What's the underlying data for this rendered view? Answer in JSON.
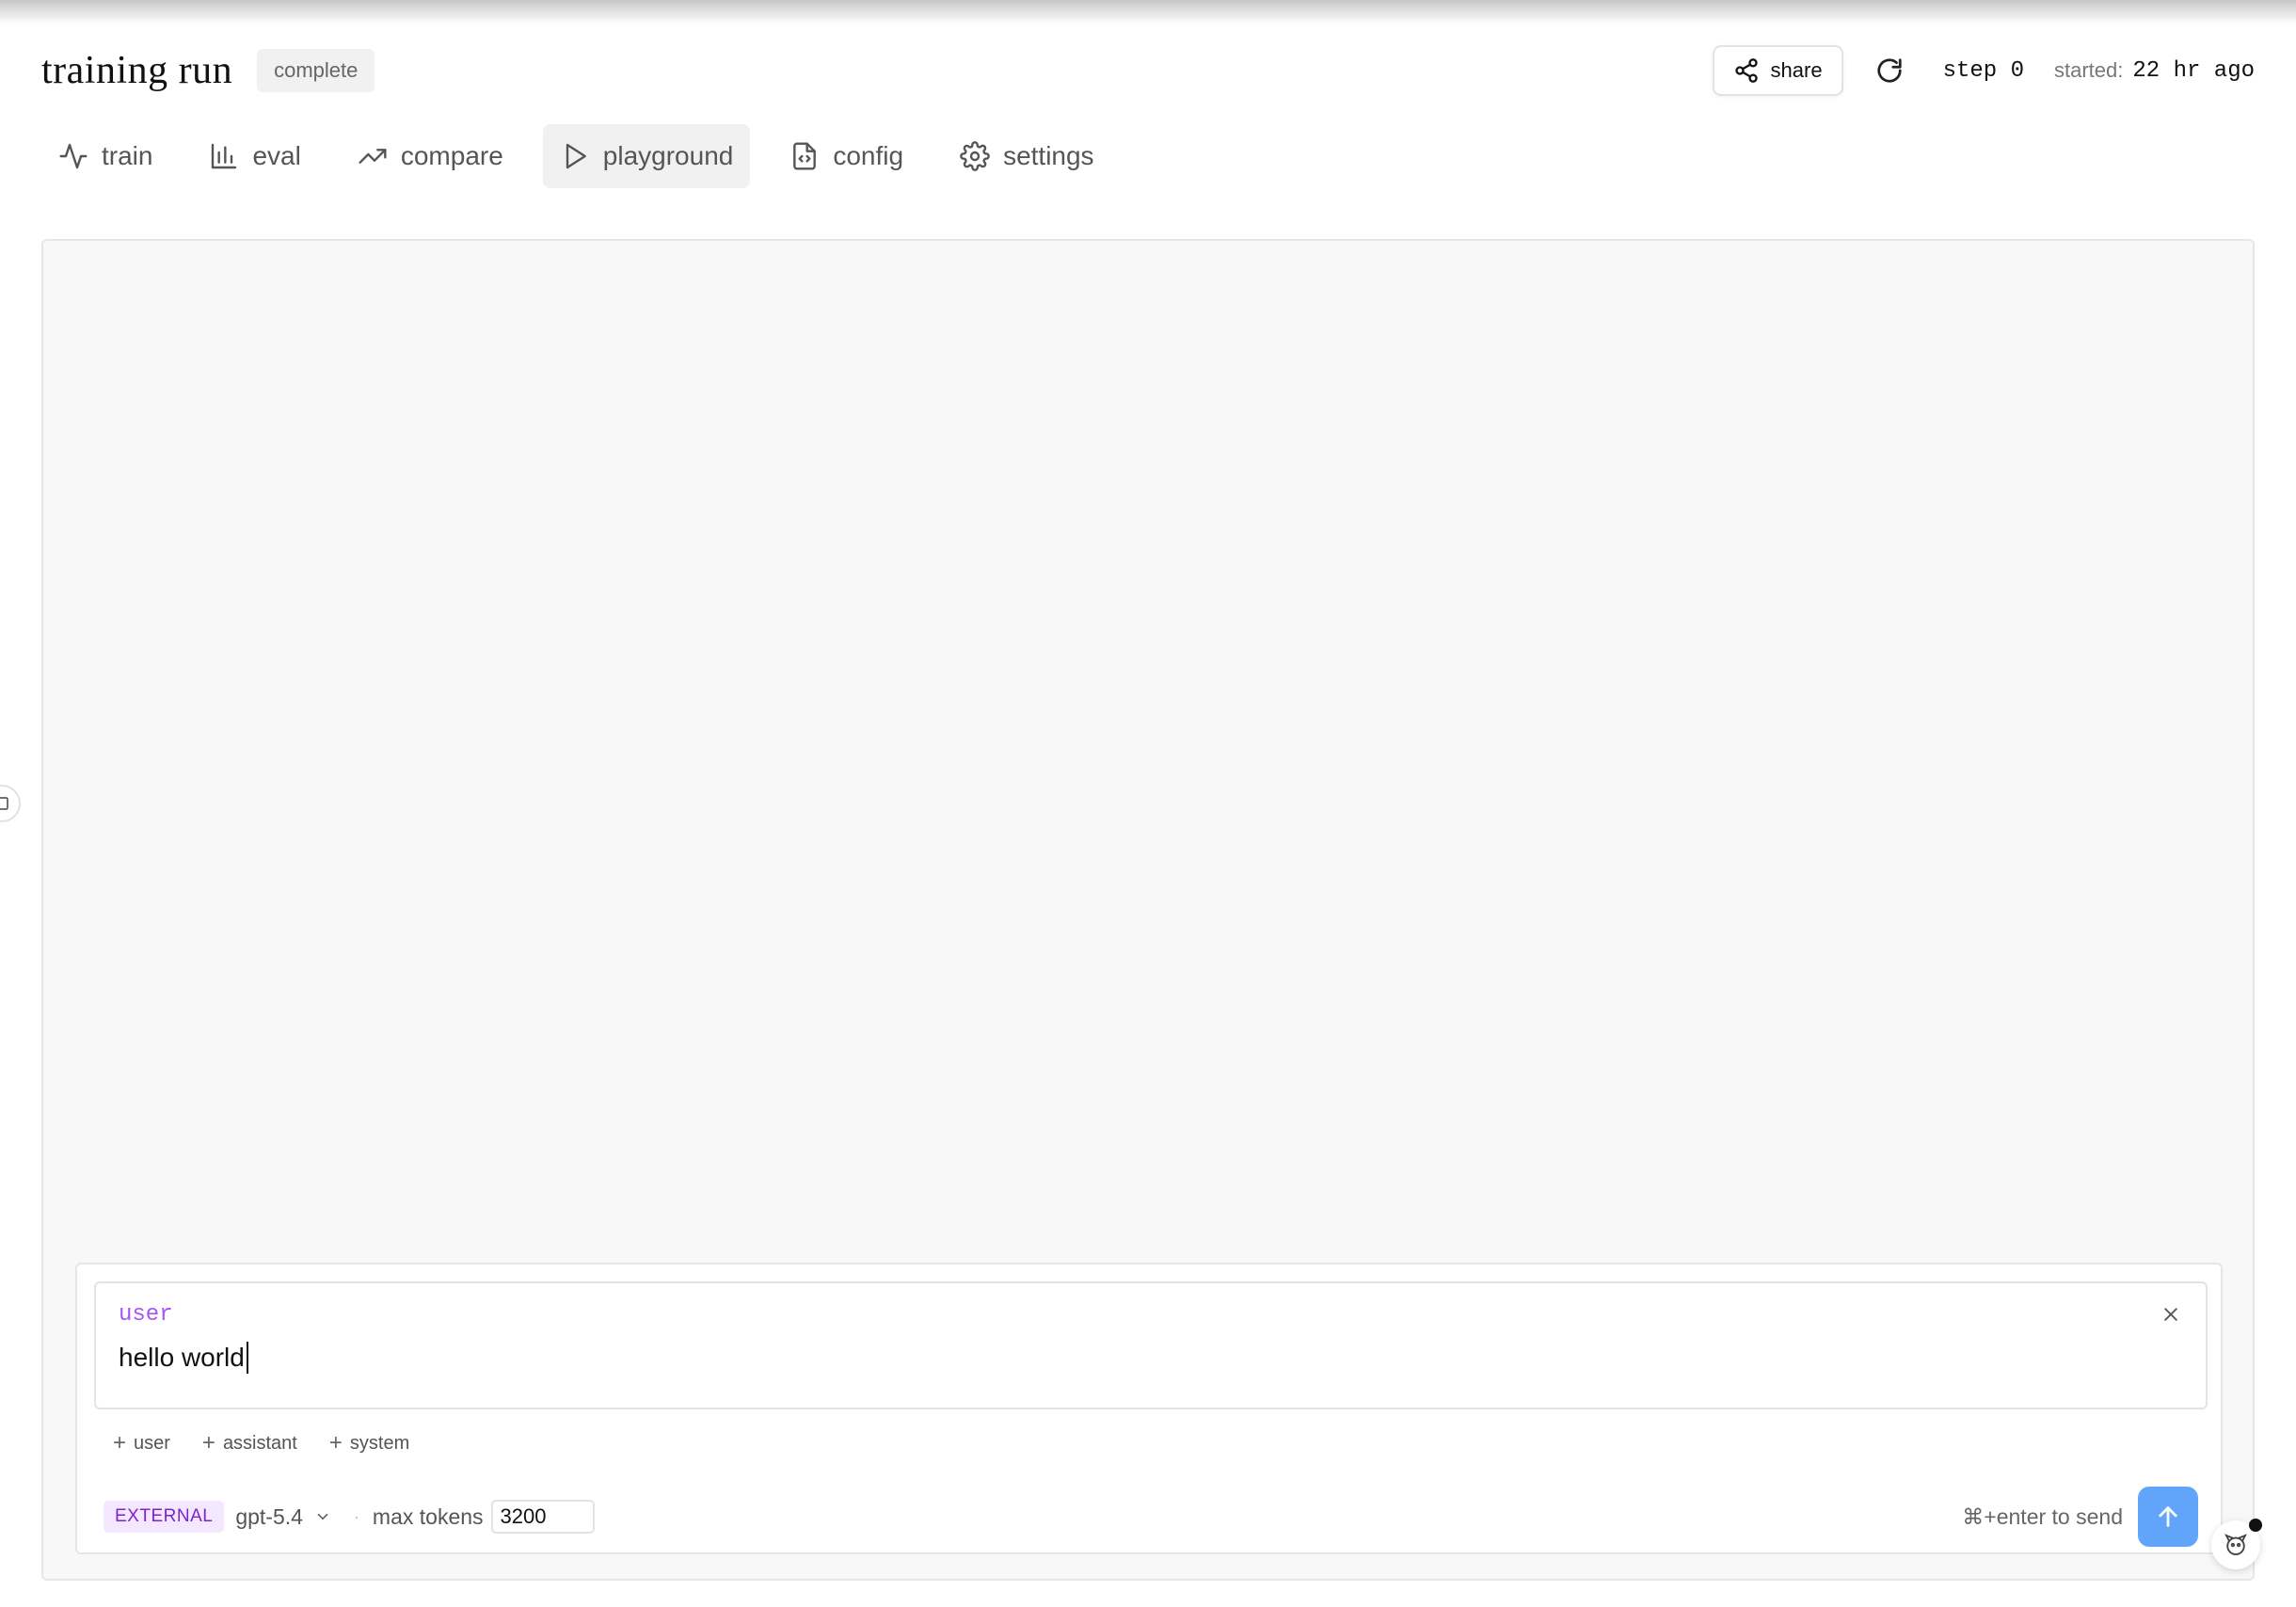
{
  "header": {
    "title": "training run",
    "status": "complete",
    "share_label": "share",
    "step": "step 0",
    "started_label": "started:",
    "started_value": "22 hr ago"
  },
  "tabs": [
    {
      "label": "train",
      "icon": "activity-icon"
    },
    {
      "label": "eval",
      "icon": "bar-chart-icon"
    },
    {
      "label": "compare",
      "icon": "trending-up-icon"
    },
    {
      "label": "playground",
      "icon": "play-icon",
      "active": true
    },
    {
      "label": "config",
      "icon": "file-code-icon"
    },
    {
      "label": "settings",
      "icon": "gear-icon"
    }
  ],
  "composer": {
    "message": {
      "role": "user",
      "text": "hello world"
    },
    "add_buttons": [
      "user",
      "assistant",
      "system"
    ],
    "badge": "EXTERNAL",
    "model": "gpt-5.4",
    "separator": "·",
    "max_tokens_label": "max tokens",
    "max_tokens_value": "3200",
    "send_hint": "⌘+enter to send"
  },
  "colors": {
    "accent_purple": "#a855f7",
    "send_button": "#60a5fa",
    "panel_bg": "#f8f8f8"
  }
}
